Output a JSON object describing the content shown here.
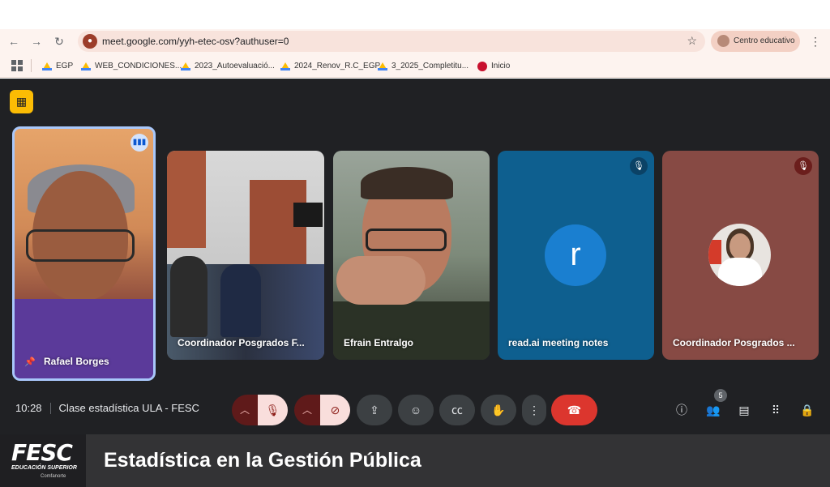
{
  "browser": {
    "url": "meet.google.com/yyh-etec-osv?authuser=0",
    "profile_name": "Centro educativo",
    "bookmarks": [
      {
        "label": "EGP"
      },
      {
        "label": "WEB_CONDICIONES..."
      },
      {
        "label": "2023_Autoevaluació..."
      },
      {
        "label": "2024_Renov_R.C_EGP"
      },
      {
        "label": "3_2025_Completitu..."
      },
      {
        "label": "Inicio"
      }
    ]
  },
  "meeting": {
    "time": "10:28",
    "title": "Clase estadística ULA - FESC",
    "participant_count": "5",
    "tiles": [
      {
        "name": "Rafael Borges",
        "state": "speaking",
        "pinned": true
      },
      {
        "name": "Coordinador Posgrados F..."
      },
      {
        "name": "Efrain Entralgo"
      },
      {
        "name": "read.ai meeting notes",
        "avatar_letter": "r",
        "muted": true
      },
      {
        "name": "Coordinador Posgrados ...",
        "muted": true
      }
    ]
  },
  "icons": {
    "speaking": "audio-bars-icon",
    "pin": "pin-icon",
    "mic_off": "mic-off-icon",
    "cam_off": "camera-off-icon",
    "present": "present-screen-icon",
    "emoji": "emoji-icon",
    "captions": "captions-icon",
    "hand": "raise-hand-icon",
    "more": "more-vert-icon",
    "end": "end-call-icon",
    "info": "info-icon",
    "people": "people-icon",
    "chat": "chat-icon",
    "activities": "apps-grid-icon",
    "host": "host-controls-icon"
  },
  "colors": {
    "meet_background": "#202124",
    "end_call": "#dc362e",
    "muted_control": "#f9dedc",
    "active_speaker_border": "#a8c7fa",
    "readai_tile": "#0e5f8f",
    "coordinator_tile": "#874a44"
  },
  "banner": {
    "logo_text": "FESC",
    "logo_subtitle": "EDUCACIÓN SUPERIOR",
    "logo_partner": "Comfanorte",
    "title": "Estadística en la Gestión Pública"
  }
}
